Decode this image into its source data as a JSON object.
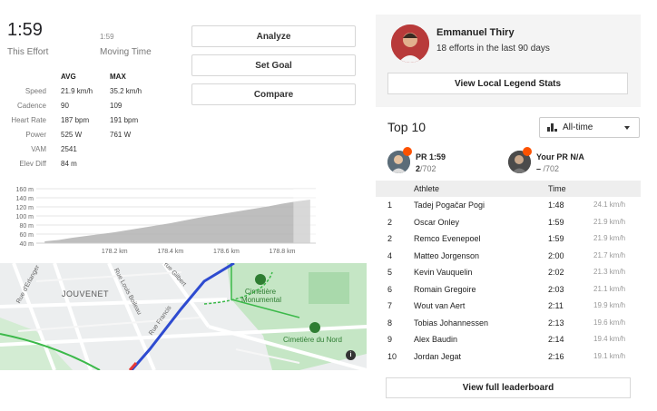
{
  "effort": {
    "time": "1:59",
    "time_label": "This Effort",
    "moving_time": "1:59",
    "moving_label": "Moving Time"
  },
  "actions": {
    "analyze": "Analyze",
    "set_goal": "Set Goal",
    "compare": "Compare"
  },
  "stats": {
    "col_avg": "AVG",
    "col_max": "MAX",
    "rows": [
      {
        "label": "Speed",
        "avg": "21.9 km/h",
        "max": "35.2 km/h"
      },
      {
        "label": "Cadence",
        "avg": "90",
        "max": "109"
      },
      {
        "label": "Heart Rate",
        "avg": "187 bpm",
        "max": "191 bpm"
      },
      {
        "label": "Power",
        "avg": "525 W",
        "max": "761 W"
      },
      {
        "label": "VAM",
        "avg": "2541",
        "max": ""
      },
      {
        "label": "Elev Diff",
        "avg": "84 m",
        "max": ""
      }
    ]
  },
  "chart_data": {
    "type": "area",
    "x": [
      177.95,
      178.0,
      178.05,
      178.1,
      178.15,
      178.2,
      178.25,
      178.3,
      178.35,
      178.4,
      178.45,
      178.5,
      178.55,
      178.6,
      178.65,
      178.7,
      178.75,
      178.8,
      178.85,
      178.9
    ],
    "y": [
      44,
      47,
      52,
      56,
      60,
      64,
      69,
      74,
      79,
      84,
      90,
      96,
      101,
      106,
      111,
      116,
      121,
      127,
      132,
      136
    ],
    "xticks": [
      "178.2 km",
      "178.4 km",
      "178.6 km",
      "178.8 km"
    ],
    "xtick_values": [
      178.2,
      178.4,
      178.6,
      178.8
    ],
    "yticks": [
      "40 m",
      "60 m",
      "80 m",
      "100 m",
      "120 m",
      "140 m",
      "160 m"
    ],
    "ytick_values": [
      40,
      60,
      80,
      100,
      120,
      140,
      160
    ],
    "xlim": [
      177.92,
      178.92
    ],
    "ylim": [
      40,
      160
    ],
    "highlight_from": 178.84,
    "grid": true
  },
  "map": {
    "labels": {
      "jouvenet": "JOUVENET",
      "rue_gilbert": "Rue Gilbert",
      "rue_boileau": "Rue Louis Boileau",
      "rue_erlanger": "Rue d'Erlanger",
      "rue_francis": "Rue Francis",
      "cem_mon_1": "Cimetière",
      "cem_mon_2": "Monumental",
      "cem_nord": "Cimetière du Nord"
    },
    "info": "i"
  },
  "legend": {
    "name": "Emmanuel Thiry",
    "efforts": "18 efforts in the last 90 days",
    "view_stats": "View Local Legend Stats"
  },
  "leaderboard": {
    "title": "Top 10",
    "filter": "All-time",
    "pr_label": "PR 1:59",
    "pr_rank": "2",
    "pr_total": "/702",
    "your_pr_label": "Your PR N/A",
    "your_rank": "–",
    "your_total": "/702",
    "col_athlete": "Athlete",
    "col_time": "Time",
    "rows": [
      {
        "rank": "1",
        "name": "Tadej Pogačar Pogi",
        "time": "1:48",
        "speed": "24.1 km/h"
      },
      {
        "rank": "2",
        "name": "Oscar Onley",
        "time": "1:59",
        "speed": "21.9 km/h"
      },
      {
        "rank": "2",
        "name": "Remco Evenepoel",
        "time": "1:59",
        "speed": "21.9 km/h"
      },
      {
        "rank": "4",
        "name": "Matteo Jorgenson",
        "time": "2:00",
        "speed": "21.7 km/h"
      },
      {
        "rank": "5",
        "name": "Kevin Vauquelin",
        "time": "2:02",
        "speed": "21.3 km/h"
      },
      {
        "rank": "6",
        "name": "Romain Gregoire",
        "time": "2:03",
        "speed": "21.1 km/h"
      },
      {
        "rank": "7",
        "name": "Wout van Aert",
        "time": "2:11",
        "speed": "19.9 km/h"
      },
      {
        "rank": "8",
        "name": "Tobias Johannessen",
        "time": "2:13",
        "speed": "19.6 km/h"
      },
      {
        "rank": "9",
        "name": "Alex Baudin",
        "time": "2:14",
        "speed": "19.4 km/h"
      },
      {
        "rank": "10",
        "name": "Jordan Jegat",
        "time": "2:16",
        "speed": "19.1 km/h"
      }
    ],
    "view_full": "View full leaderboard"
  },
  "colors": {
    "accent": "#fc5200",
    "route": "#2e4bd0",
    "chart_fill": "#b3b3b3",
    "chart_highlight": "#d6d6d6",
    "park": "#bfe3c0"
  }
}
